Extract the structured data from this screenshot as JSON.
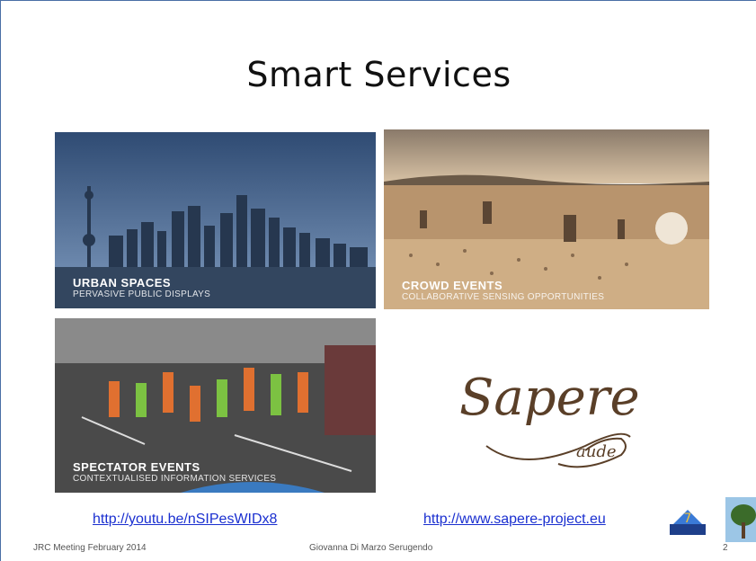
{
  "slide": {
    "title": "Smart Services",
    "panels": [
      {
        "heading": "URBAN SPACES",
        "subtitle": "PERVASIVE PUBLIC DISPLAYS"
      },
      {
        "heading": "CROWD EVENTS",
        "subtitle": "COLLABORATIVE SENSING OPPORTUNITIES"
      },
      {
        "heading": "SPECTATOR EVENTS",
        "subtitle": "CONTEXTUALISED INFORMATION SERVICES"
      }
    ],
    "logo": {
      "text_main": "Sapere",
      "text_sub": "aude"
    },
    "links": {
      "video": "http://youtu.be/nSIPesWIDx8",
      "project": "http://www.sapere-project.eu"
    },
    "footer": {
      "left": "JRC Meeting February 2014",
      "center": "Giovanna Di Marzo Serugendo",
      "page": "2"
    }
  },
  "colors": {
    "link": "#1a2fd0",
    "urban_sky": "#3f5c83",
    "desert": "#c9a77e",
    "road": "#4a4a4a"
  }
}
